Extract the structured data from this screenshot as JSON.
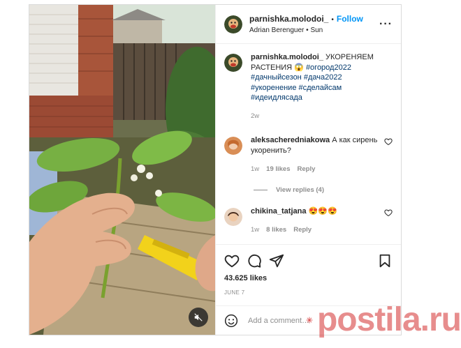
{
  "post": {
    "author": {
      "username": "parnishka.molodoi_",
      "follow_label": "Follow",
      "location": "Adrian Berenguer • Sun",
      "more_icon": "more-horizontal-icon"
    },
    "caption": {
      "username": "parnishka.molodoi_",
      "text": " УКОРЕНЯЕМ РАСТЕНИЯ 😱 ",
      "tags": [
        "#огород2022",
        "#дачныйсезон",
        "#дача2022",
        "#укоренение",
        "#сделайсам",
        "#идеидлясада"
      ],
      "time": "2w"
    },
    "comments": [
      {
        "username": "aleksacherednia kowa",
        "username_exact": "aleksacherednia kowa",
        "text": "А как сирень укоренить?",
        "time": "1w",
        "likes": "19 likes",
        "reply_label": "Reply",
        "view_replies": "View replies (4)"
      },
      {
        "username": "chikina_tatjana",
        "text": "😍😍😍",
        "time": "1w",
        "likes": "8 likes",
        "reply_label": "Reply"
      }
    ],
    "likes_count": "43.625 likes",
    "date": "JUNE 7",
    "add_comment_placeholder": "Add a comment…"
  },
  "icons": {
    "like": "heart-icon",
    "comment": "comment-icon",
    "share": "send-icon",
    "save": "bookmark-icon",
    "emoji": "emoji-icon",
    "mute": "audio-muted-icon"
  },
  "watermark": {
    "text": "postila.ru"
  },
  "colors": {
    "link": "#0095f6",
    "hashtag": "#00376b",
    "secondary_text": "#8e8e8e",
    "watermark": "#d32f2f"
  }
}
